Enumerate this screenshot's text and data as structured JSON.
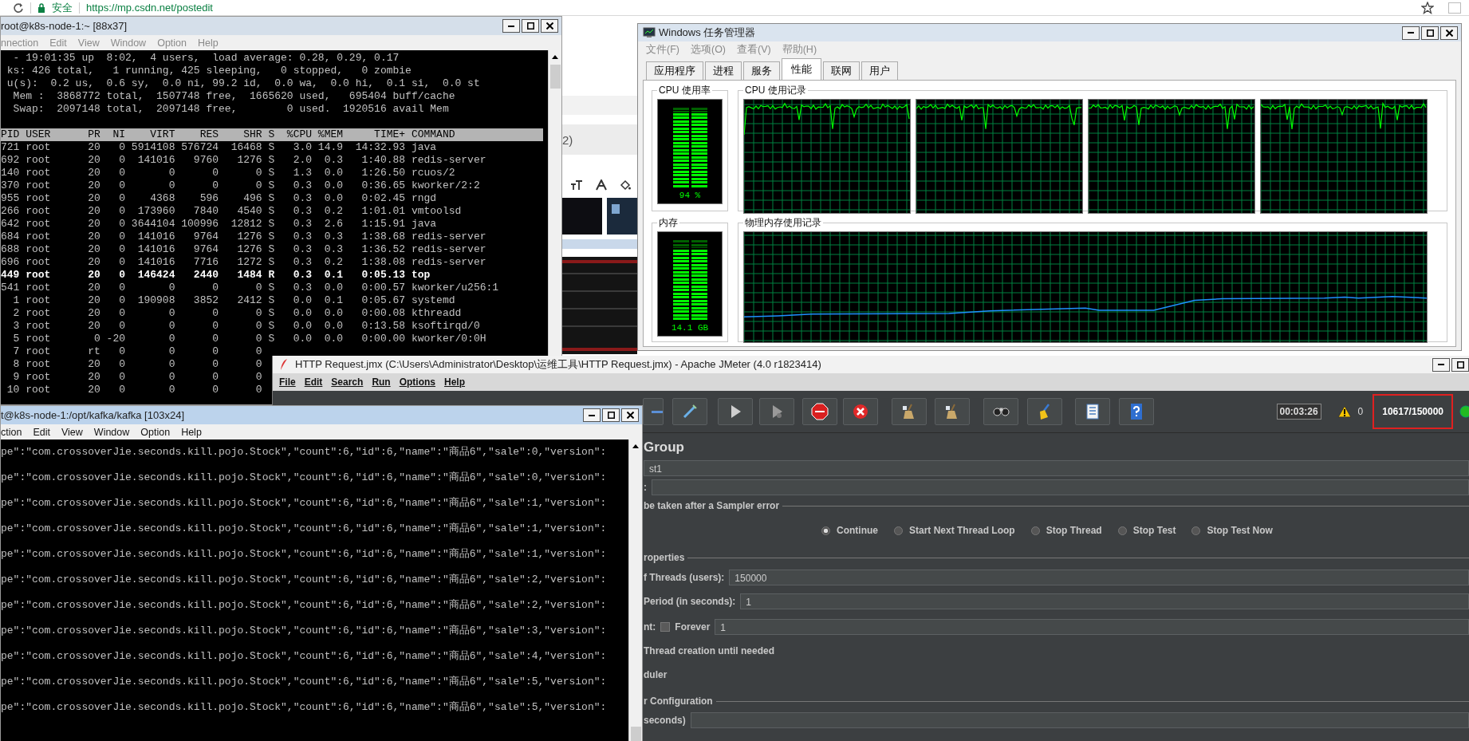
{
  "browser": {
    "security_label": "安全",
    "url": "https://mp.csdn.net/postedit",
    "page_fragment": "2)"
  },
  "top_terminal": {
    "title": "root@k8s-node-1:~ [88x37]",
    "active": false,
    "menu": [
      "nnection",
      "Edit",
      "View",
      "Window",
      "Option",
      "Help"
    ],
    "summary": [
      "  - 19:01:35 up  8:02,  4 users,  load average: 0.28, 0.29, 0.17",
      " ks: 426 total,   1 running, 425 sleeping,   0 stopped,   0 zombie",
      " u(s):  0.2 us,  0.6 sy,  0.0 ni, 99.2 id,  0.0 wa,  0.0 hi,  0.1 si,  0.0 st",
      "  Mem :  3868772 total,  1507748 free,  1665620 used,   695404 buff/cache",
      "  Swap:  2097148 total,  2097148 free,        0 used.  1920516 avail Mem"
    ],
    "column_header": "PID USER      PR  NI    VIRT    RES    SHR S  %CPU %MEM     TIME+ COMMAND",
    "rows": [
      {
        "text": "721 root      20   0 5914108 576724  16468 S   3.0 14.9  14:32.93 java",
        "bold": false
      },
      {
        "text": "692 root      20   0  141016   9760   1276 S   2.0  0.3   1:40.88 redis-server",
        "bold": false
      },
      {
        "text": "140 root      20   0       0      0      0 S   1.3  0.0   1:26.50 rcuos/2",
        "bold": false
      },
      {
        "text": "370 root      20   0       0      0      0 S   0.3  0.0   0:36.65 kworker/2:2",
        "bold": false
      },
      {
        "text": "955 root      20   0    4368    596    496 S   0.3  0.0   0:02.45 rngd",
        "bold": false
      },
      {
        "text": "266 root      20   0  173960   7840   4540 S   0.3  0.2   1:01.01 vmtoolsd",
        "bold": false
      },
      {
        "text": "642 root      20   0 3644104 100996  12812 S   0.3  2.6   1:15.91 java",
        "bold": false
      },
      {
        "text": "684 root      20   0  141016   9764   1276 S   0.3  0.3   1:38.68 redis-server",
        "bold": false
      },
      {
        "text": "688 root      20   0  141016   9764   1276 S   0.3  0.3   1:36.52 redis-server",
        "bold": false
      },
      {
        "text": "696 root      20   0  141016   7716   1272 S   0.3  0.2   1:38.08 redis-server",
        "bold": false
      },
      {
        "text": "449 root      20   0  146424   2440   1484 R   0.3  0.1   0:05.13 top",
        "bold": true
      },
      {
        "text": "541 root      20   0       0      0      0 S   0.3  0.0   0:00.57 kworker/u256:1",
        "bold": false
      },
      {
        "text": "  1 root      20   0  190908   3852   2412 S   0.0  0.1   0:05.67 systemd",
        "bold": false
      },
      {
        "text": "  2 root      20   0       0      0      0 S   0.0  0.0   0:00.08 kthreadd",
        "bold": false
      },
      {
        "text": "  3 root      20   0       0      0      0 S   0.0  0.0   0:13.58 ksoftirqd/0",
        "bold": false
      },
      {
        "text": "  5 root       0 -20       0      0      0 S   0.0  0.0   0:00.00 kworker/0:0H",
        "bold": false
      },
      {
        "text": "  7 root      rt   0       0      0      0",
        "bold": false
      },
      {
        "text": "  8 root      20   0       0      0      0",
        "bold": false
      },
      {
        "text": "  9 root      20   0       0      0      0",
        "bold": false
      },
      {
        "text": " 10 root      20   0       0      0      0",
        "bold": false
      }
    ]
  },
  "task_manager": {
    "title": "Windows 任务管理器",
    "menu": [
      "文件(F)",
      "选项(O)",
      "查看(V)",
      "帮助(H)"
    ],
    "tabs": [
      {
        "label": "应用程序",
        "selected": false
      },
      {
        "label": "进程",
        "selected": false
      },
      {
        "label": "服务",
        "selected": false
      },
      {
        "label": "性能",
        "selected": true
      },
      {
        "label": "联网",
        "selected": false
      },
      {
        "label": "用户",
        "selected": false
      }
    ],
    "cpu_usage": {
      "label": "CPU 使用率",
      "reading": "94 %",
      "level": 0.94
    },
    "cpu_history": {
      "label": "CPU 使用记录"
    },
    "memory": {
      "label": "内存",
      "reading": "14.1 GB",
      "level": 0.9
    },
    "memory_history": {
      "label": "物理内存使用记录"
    }
  },
  "jmeter": {
    "title": "HTTP Request.jmx (C:\\Users\\Administrator\\Desktop\\运维工具\\HTTP Request.jmx) - Apache JMeter (4.0 r1823414)",
    "menu": [
      "File",
      "Edit",
      "Search",
      "Run",
      "Options",
      "Help"
    ],
    "timer": "00:03:26",
    "warning_count": "0",
    "thread_count": "10617/150000",
    "thread_count_highlighted": true,
    "thread_group": {
      "heading": "Group",
      "name_value": "st1",
      "comments_label": ":",
      "error_action": {
        "title": "be taken after a Sampler error",
        "options": [
          {
            "label": "Continue",
            "selected": true
          },
          {
            "label": "Start Next Thread Loop",
            "selected": false
          },
          {
            "label": "Stop Thread",
            "selected": false
          },
          {
            "label": "Stop Test",
            "selected": false
          },
          {
            "label": "Stop Test Now",
            "selected": false
          }
        ]
      },
      "properties": {
        "title": "roperties",
        "threads_label": "f Threads (users):",
        "threads_value": "150000",
        "ramp_label": "Period (in seconds):",
        "ramp_value": "1",
        "loop_label": "nt:",
        "forever_label": "Forever",
        "forever_checked": false,
        "loop_value": "1",
        "delay_label": "Thread creation until needed",
        "scheduler_label": "duler"
      },
      "scheduler": {
        "title": "r Configuration",
        "duration_label": "seconds)"
      }
    }
  },
  "kafka_terminal": {
    "title": "t@k8s-node-1:/opt/kafka/kafka [103x24]",
    "active": true,
    "menu": [
      "ction",
      "Edit",
      "View",
      "Window",
      "Option",
      "Help"
    ],
    "lines": [
      "pe\":\"com.crossoverJie.seconds.kill.pojo.Stock\",\"count\":6,\"id\":6,\"name\":\"商品6\",\"sale\":0,\"version\":",
      "pe\":\"com.crossoverJie.seconds.kill.pojo.Stock\",\"count\":6,\"id\":6,\"name\":\"商品6\",\"sale\":0,\"version\":",
      "pe\":\"com.crossoverJie.seconds.kill.pojo.Stock\",\"count\":6,\"id\":6,\"name\":\"商品6\",\"sale\":1,\"version\":",
      "pe\":\"com.crossoverJie.seconds.kill.pojo.Stock\",\"count\":6,\"id\":6,\"name\":\"商品6\",\"sale\":1,\"version\":",
      "pe\":\"com.crossoverJie.seconds.kill.pojo.Stock\",\"count\":6,\"id\":6,\"name\":\"商品6\",\"sale\":1,\"version\":",
      "pe\":\"com.crossoverJie.seconds.kill.pojo.Stock\",\"count\":6,\"id\":6,\"name\":\"商品6\",\"sale\":2,\"version\":",
      "pe\":\"com.crossoverJie.seconds.kill.pojo.Stock\",\"count\":6,\"id\":6,\"name\":\"商品6\",\"sale\":2,\"version\":",
      "pe\":\"com.crossoverJie.seconds.kill.pojo.Stock\",\"count\":6,\"id\":6,\"name\":\"商品6\",\"sale\":3,\"version\":",
      "pe\":\"com.crossoverJie.seconds.kill.pojo.Stock\",\"count\":6,\"id\":6,\"name\":\"商品6\",\"sale\":4,\"version\":",
      "pe\":\"com.crossoverJie.seconds.kill.pojo.Stock\",\"count\":6,\"id\":6,\"name\":\"商品6\",\"sale\":5,\"version\":",
      "pe\":\"com.crossoverJie.seconds.kill.pojo.Stock\",\"count\":6,\"id\":6,\"name\":\"商品6\",\"sale\":5,\"version\":"
    ]
  }
}
